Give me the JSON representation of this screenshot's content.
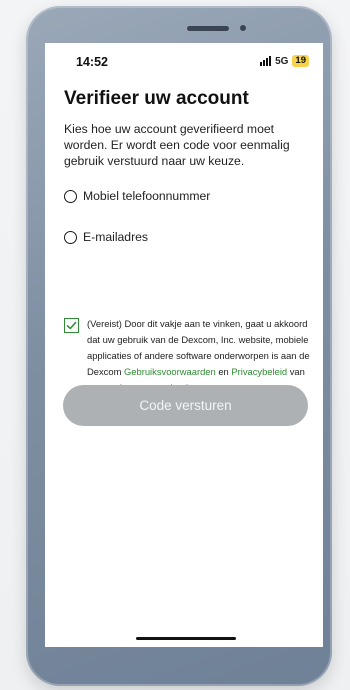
{
  "status_bar": {
    "time": "14:52",
    "network": "5G",
    "battery": "19"
  },
  "page": {
    "title": "Verifieer uw account",
    "intro": "Kies hoe uw account geverifieerd moet worden. Er wordt een code voor eenmalig gebruik verstuurd naar uw keuze."
  },
  "options": [
    {
      "label": "Mobiel telefoonnummer",
      "selected": false
    },
    {
      "label": "E-mailadres",
      "selected": false
    }
  ],
  "consent": {
    "checked": true,
    "text_before": "(Vereist) Door dit vakje aan te vinken, gaat u akkoord dat uw gebruik van de Dexcom, Inc. website, mobiele applicaties of andere software onderworpen is aan de Dexcom ",
    "terms_link": "Gebruiksvoorwaarden",
    "text_middle": " en ",
    "privacy_link": "Privacybeleid",
    "text_after": " van toepassing voor uw land."
  },
  "submit_button": {
    "label": "Code versturen",
    "enabled": false
  },
  "colors": {
    "link_green": "#2e8b34",
    "button_disabled": "#aeb1b4",
    "battery_badge": "#f6d34a"
  }
}
